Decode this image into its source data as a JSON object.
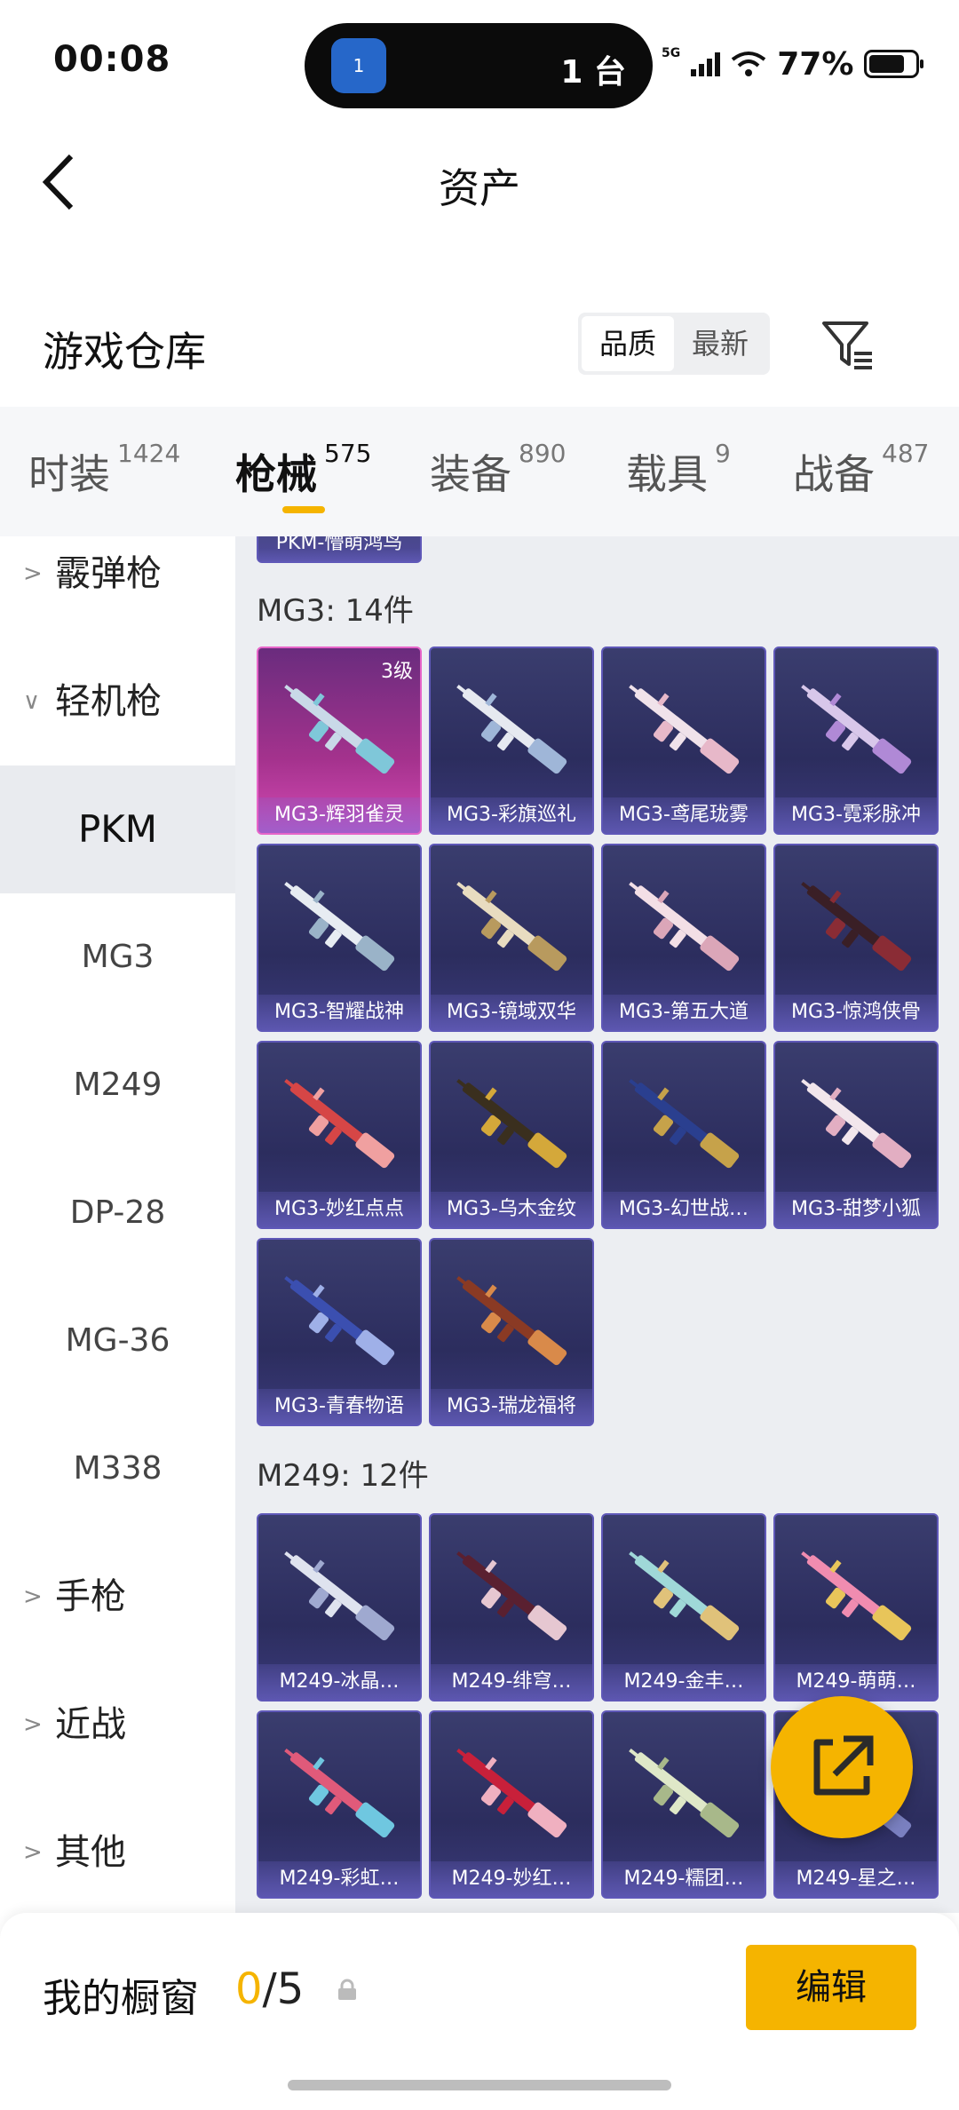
{
  "status": {
    "time": "00:08",
    "island_badge": "1",
    "island_text": "1 台",
    "network": "5G",
    "battery": "77%",
    "battery_level": 0.77
  },
  "header": {
    "title": "资产"
  },
  "warehouse": {
    "title": "游戏仓库",
    "sort": [
      "品质",
      "最新"
    ]
  },
  "tabs": [
    {
      "label": "时装",
      "count": "1424"
    },
    {
      "label": "枪械",
      "count": "575"
    },
    {
      "label": "装备",
      "count": "890"
    },
    {
      "label": "载具",
      "count": "9"
    },
    {
      "label": "战备",
      "count": "487"
    }
  ],
  "sidebar": {
    "groups": [
      "霰弹枪",
      "轻机枪",
      "手枪",
      "近战",
      "其他"
    ],
    "subs": [
      "PKM",
      "MG3",
      "M249",
      "DP-28",
      "MG-36",
      "M338"
    ]
  },
  "content": {
    "partial_top": "PKM-懵萌鸿鸟",
    "mg3_title": "MG3: 14件",
    "mg3_level": "3级",
    "mg3_items": [
      "MG3-辉羽雀灵",
      "MG3-彩旗巡礼",
      "MG3-鸢尾珑雾",
      "MG3-霓彩脉冲",
      "MG3-智耀战神",
      "MG3-镜域双华",
      "MG3-第五大道",
      "MG3-惊鸿侠骨",
      "MG3-妙红点点",
      "MG3-乌木金纹",
      "MG3-幻世战…",
      "MG3-甜梦小狐",
      "MG3-青春物语",
      "MG3-瑞龙福将"
    ],
    "m249_title": "M249: 12件",
    "m249_items": [
      "M249-冰晶…",
      "M249-绯穹…",
      "M249-金丰…",
      "M249-萌萌…",
      "M249-彩虹…",
      "M249-妙红…",
      "M249-糯团…",
      "M249-星之…"
    ]
  },
  "bottom": {
    "showcase_label": "我的橱窗",
    "showcase_current": "0",
    "showcase_total": "/5",
    "edit_label": "编辑"
  },
  "colors": {
    "accent": "#f5b400",
    "card_bg": "#2c2d5e",
    "card_gold": "#a4328d"
  },
  "icons": {
    "back": "back-arrow-icon",
    "filter": "filter-icon",
    "share": "share-icon",
    "lock": "lock-icon"
  }
}
